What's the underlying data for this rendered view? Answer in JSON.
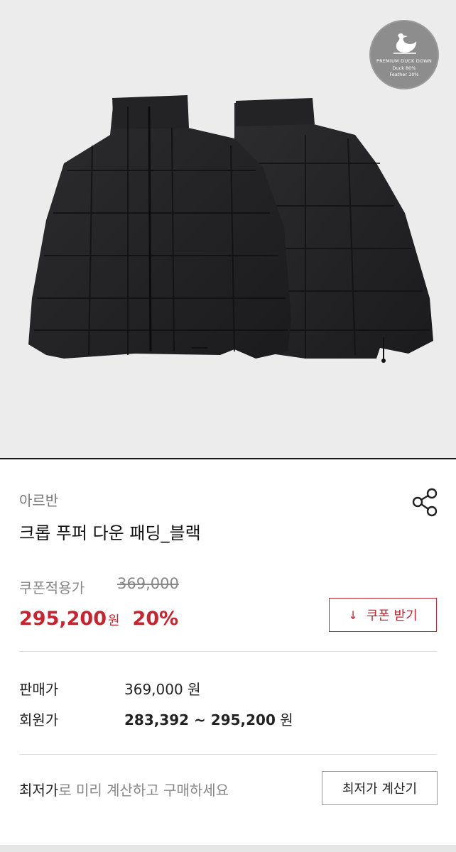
{
  "badge": {
    "line1": "PREMIUM DUCK DOWN",
    "line2": "Duck 80%",
    "line3": "Feather 10%"
  },
  "product": {
    "brand": "아르반",
    "title": "크롭 푸퍼 다운 패딩_블랙"
  },
  "pricing": {
    "coupon_label": "쿠폰적용가",
    "original_price": "369,000",
    "sale_price": "295,200",
    "won": "원",
    "discount": "20%",
    "coupon_button": "쿠폰 받기",
    "coupon_icon": "↓"
  },
  "details": {
    "list_price_label": "판매가",
    "list_price_value": "369,000 원",
    "member_price_label": "회원가",
    "member_price_value": "283,392 ~ 295,200",
    "member_price_unit": "원"
  },
  "lowest": {
    "emphasis": "최저가",
    "rest": "로 미리 계산하고 구매하세요",
    "button": "최저가 계산기"
  },
  "colors": {
    "accent": "#c8232f",
    "hero_bg": "#ececec"
  },
  "icons": {
    "share": "share-icon",
    "download": "download-arrow-icon"
  }
}
